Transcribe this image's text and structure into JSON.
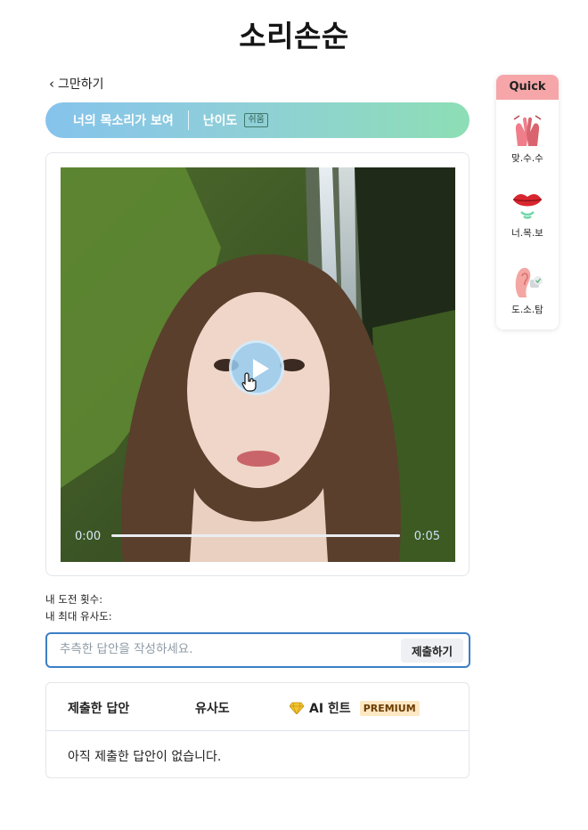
{
  "app": {
    "title": "소리손순"
  },
  "nav": {
    "back_label": "그만하기"
  },
  "mode_banner": {
    "mode_name": "너의 목소리가 보여",
    "difficulty_label": "난이도",
    "difficulty_value": "쉬움"
  },
  "player": {
    "current_time": "0:00",
    "total_time": "0:05",
    "progress": 0.0
  },
  "stats": {
    "attempts_label": "내 도전 횟수:",
    "best_similarity_label": "내 최대 유사도:"
  },
  "answer": {
    "placeholder": "추측한 답안을 작성하세요.",
    "value": "",
    "submit_label": "제출하기"
  },
  "results": {
    "col_answer": "제출한 답안",
    "col_similarity": "유사도",
    "col_hint": "AI 힌트",
    "premium_badge": "PREMIUM",
    "empty_message": "아직 제출한 답안이 없습니다."
  },
  "quick": {
    "title": "Quick",
    "items": [
      {
        "label": "맞.수.수",
        "icon": "sign-language-hands-icon"
      },
      {
        "label": "너.목.보",
        "icon": "lips-icon"
      },
      {
        "label": "도.소.탐",
        "icon": "ear-icon"
      }
    ]
  },
  "colors": {
    "accent": "#3c7fc6",
    "quick_header": "#f6a6a9",
    "banner_start": "#86c3ec",
    "banner_end": "#8ddeb5",
    "premium_bg": "#fde8c3"
  }
}
